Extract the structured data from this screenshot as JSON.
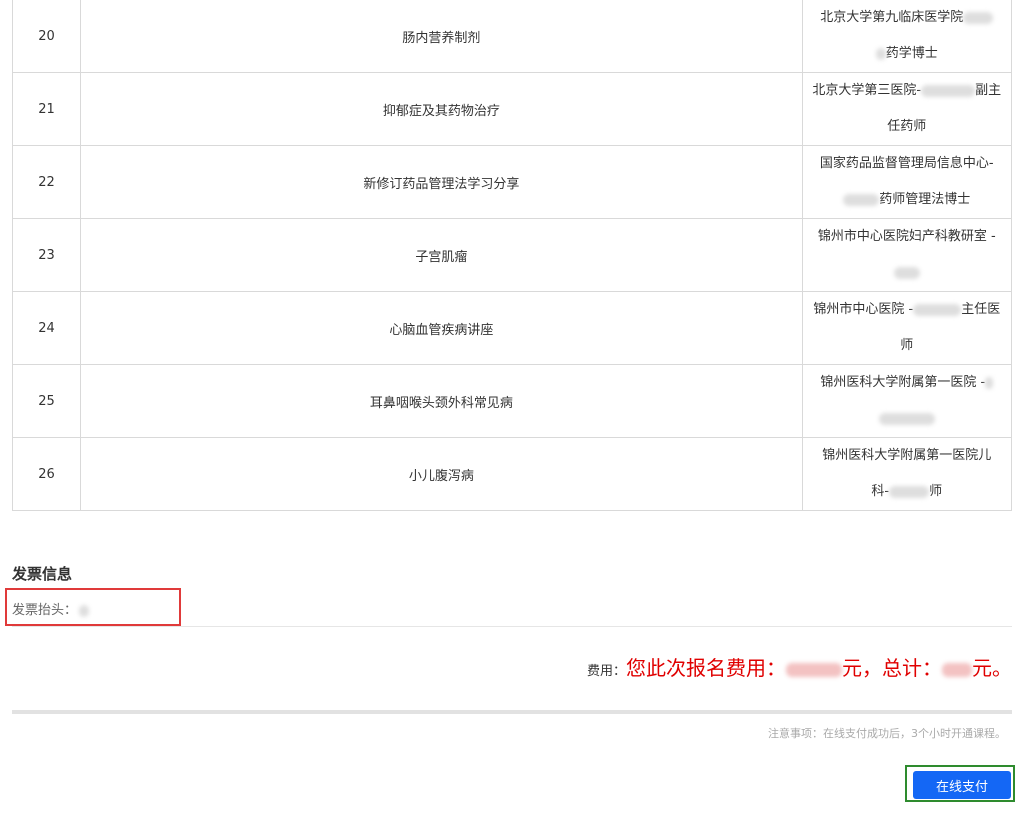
{
  "courses": [
    {
      "num": "20",
      "topic": "肠内营养制剂",
      "speaker_line1": "北京大学第九临床医学院",
      "speaker_line2": "药学博士"
    },
    {
      "num": "21",
      "topic": "抑郁症及其药物治疗",
      "speaker_line1": "北京大学第三医院-",
      "speaker_line1_tail": "副主",
      "speaker_line2": "任药师"
    },
    {
      "num": "22",
      "topic": "新修订药品管理法学习分享",
      "speaker_line1": "国家药品监督管理局信息中心-",
      "speaker_line2": "药师管理法博士"
    },
    {
      "num": "23",
      "topic": "子宫肌瘤",
      "speaker_line1": "锦州市中心医院妇产科教研室 -",
      "speaker_line2": ""
    },
    {
      "num": "24",
      "topic": "心脑血管疾病讲座",
      "speaker_line1": "锦州市中心医院 -",
      "speaker_line1_tail": "主任医",
      "speaker_line2": "师"
    },
    {
      "num": "25",
      "topic": "耳鼻咽喉头颈外科常见病",
      "speaker_line1": "锦州医科大学附属第一医院 -",
      "speaker_line2": ""
    },
    {
      "num": "26",
      "topic": "小儿腹泻病",
      "speaker_line1": "锦州医科大学附属第一医院儿",
      "speaker_line2": "科-",
      "speaker_line2_tail": "师"
    }
  ],
  "invoice": {
    "heading": "发票信息",
    "title_label": "发票抬头："
  },
  "fee": {
    "label": "费用：",
    "part1": "您此次报名费用：",
    "part2": "元，总计：",
    "part3": "元。"
  },
  "notice": "注意事项：在线支付成功后，3个小时开通课程。",
  "pay_button_label": "在线支付",
  "colors": {
    "accent_blue": "#1467f5",
    "fee_red": "#e00000",
    "annotation_red": "#e03a3a",
    "annotation_green": "#2e8b2e"
  }
}
